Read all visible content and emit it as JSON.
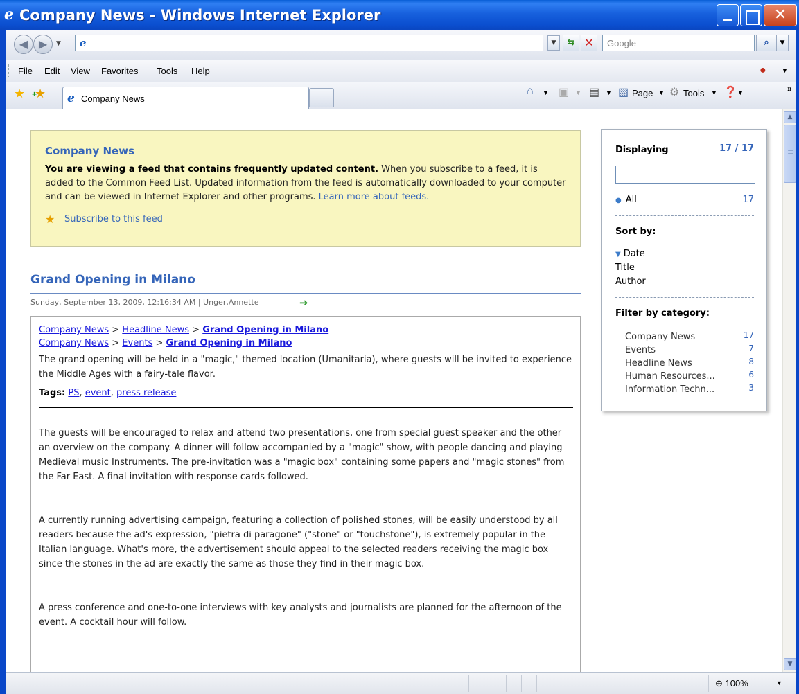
{
  "window": {
    "title": "Company News - Windows Internet Explorer"
  },
  "addressbar": {
    "url": "",
    "search_placeholder": "Google"
  },
  "menu": {
    "items": [
      "File",
      "Edit",
      "View",
      "Favorites",
      "Tools",
      "Help"
    ]
  },
  "tabs": {
    "active_label": "Company News"
  },
  "command_bar": {
    "page_label": "Page",
    "tools_label": "Tools"
  },
  "feed_banner": {
    "title": "Company News",
    "bold_text": "You are viewing a feed that contains frequently updated content.",
    "text": " When you subscribe to a feed, it is added to the Common Feed List. Updated information from the feed is automatically downloaded to your computer and can be viewed in Internet Explorer and other programs. ",
    "learn_more": "Learn more about feeds.",
    "subscribe": "Subscribe to this feed"
  },
  "article": {
    "title": "Grand Opening in Milano",
    "meta": "Sunday, September 13, 2009, 12:16:34 AM | Unger,Annette",
    "breadcrumbs": [
      [
        "Company News",
        "Headline News",
        "Grand Opening in Milano"
      ],
      [
        "Company News",
        "Events",
        "Grand Opening in Milano"
      ]
    ],
    "crumb_separator": ">",
    "intro": "The grand opening will be held in a \"magic,\" themed location (Umanitaria), where guests will be invited to experience the Middle Ages with a fairy-tale flavor.",
    "tags_label": "Tags:",
    "tags": [
      "PS",
      "event",
      "press release"
    ],
    "paragraphs": [
      "The guests will be encouraged to relax and attend two presentations, one from special guest speaker and the other an overview on the company. A dinner will follow accompanied by a \"magic\" show, with people dancing and playing Medieval music Instruments. The pre-invitation was a \"magic box\" containing some papers and \"magic stones\" from the Far East. A final invitation with response cards followed.",
      "A currently running advertising campaign, featuring a collection of polished stones, will be easily understood by all readers because the ad's expression, \"pietra di paragone\" (\"stone\" or \"touchstone\"), is extremely popular in the Italian language. What's more, the advertisement should appeal to the selected readers receiving the magic box since the stones in the ad are exactly the same as those they find in their magic box.",
      "A press conference and one-to-one interviews with key analysts and journalists are planned for the afternoon of the event. A cocktail hour will follow."
    ]
  },
  "side_panel": {
    "displaying_label": "Displaying",
    "displaying_count": "17 / 17",
    "all_label": "All",
    "all_count": "17",
    "sort_label": "Sort by:",
    "sort_options": [
      "Date",
      "Title",
      "Author"
    ],
    "filter_label": "Filter by category:",
    "categories": [
      {
        "name": "Company News",
        "count": "17"
      },
      {
        "name": "Events",
        "count": "7"
      },
      {
        "name": "Headline News",
        "count": "8"
      },
      {
        "name": "Human Resources...",
        "count": "6"
      },
      {
        "name": "Information Techn...",
        "count": "3"
      }
    ]
  },
  "status": {
    "zoom": "100%"
  },
  "icons": {
    "accent": "#3565b9",
    "titlebar": "#0a5fd6"
  }
}
